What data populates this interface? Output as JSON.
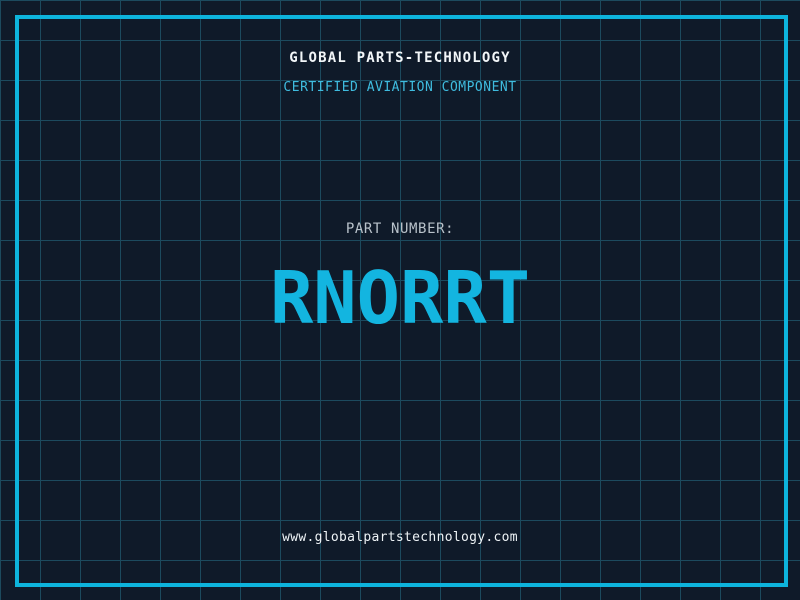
{
  "colors": {
    "background": "#0f1a29",
    "grid_line": "#1c4a5e",
    "frame": "#0db4dc",
    "title": "#f2f6f8",
    "subtitle": "#3fbcdf",
    "part_label": "#b9c2ca",
    "part_number": "#13b5e0",
    "url": "#eef3f6"
  },
  "header": {
    "title": "GLOBAL PARTS-TECHNOLOGY",
    "subtitle": "CERTIFIED AVIATION COMPONENT"
  },
  "part": {
    "label": "PART NUMBER:",
    "value": "RNORRT"
  },
  "footer": {
    "url": "www.globalpartstechnology.com"
  },
  "layout_meta": {
    "grid_cell_px": "40"
  }
}
